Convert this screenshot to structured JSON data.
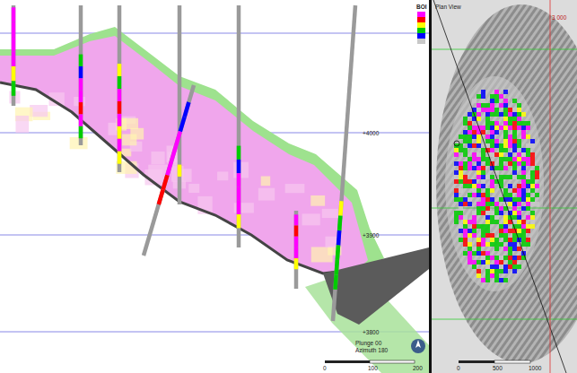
{
  "section_view": {
    "legend": {
      "title": "BOI",
      "colors": [
        "#ff00ff",
        "#ff0000",
        "#ffff00",
        "#00cc00",
        "#0000ff",
        "#c8c8c8"
      ]
    },
    "elevations": [
      "+4000",
      "+3900",
      "+3800"
    ],
    "orientation": {
      "plunge": "Plunge 00",
      "azimuth": "Azimuth 180"
    },
    "scale": [
      "0",
      "100",
      "200"
    ],
    "drillholes": [
      {
        "intervals": [
          "#ff00ff",
          "#ff00ff",
          "#ff00ff",
          "#ff00ff",
          "#ffff00",
          "#00cc00"
        ]
      },
      {
        "intervals": [
          "#00cc00",
          "#0000ff",
          "#ff00ff",
          "#ff00ff",
          "#ff0000",
          "#ff00ff",
          "#00cc00"
        ]
      },
      {
        "intervals": [
          "#ffff00",
          "#00cc00",
          "#ff00ff",
          "#ff0000",
          "#ff00ff",
          "#ffff00",
          "#ff00ff",
          "#ffff00"
        ]
      },
      {
        "intervals": [
          "#ffff00"
        ]
      },
      {
        "intervals": [
          "#0000ff",
          "#0000ff",
          "#ff00ff",
          "#ff00ff",
          "#ff00ff",
          "#ff0000",
          "#ff0000"
        ]
      },
      {
        "intervals": [
          "#00cc00",
          "#0000ff",
          "#ff00ff",
          "#ff00ff",
          "#ff00ff",
          "#ffff00"
        ]
      },
      {
        "intervals": [
          "#ff00ff",
          "#ff0000",
          "#ff00ff",
          "#ff00ff",
          "#ffff00"
        ]
      },
      {
        "intervals": [
          "#ffff00",
          "#00cc00",
          "#0000ff",
          "#00cc00",
          "#00cc00",
          "#00cc00"
        ]
      }
    ]
  },
  "plan_view": {
    "title": "Plan View",
    "grid_label": "3 000",
    "scale": [
      "0",
      "500",
      "1000"
    ]
  }
}
